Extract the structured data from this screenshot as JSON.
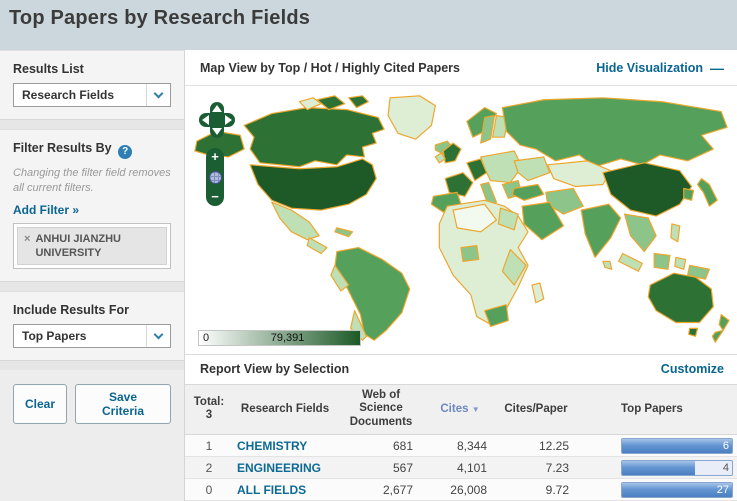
{
  "page": {
    "title": "Top Papers by Research Fields"
  },
  "sidebar": {
    "results_list_label": "Results List",
    "results_list_value": "Research Fields",
    "filter_heading": "Filter Results By",
    "filter_note": "Changing the filter field removes all current filters.",
    "add_filter_label": "Add Filter »",
    "filter_chip": "ANHUI JIANZHU UNIVERSITY",
    "include_label": "Include Results For",
    "include_value": "Top Papers",
    "clear_label": "Clear",
    "save_label": "Save Criteria"
  },
  "icons": {
    "help": "?",
    "close": "×",
    "minus_dash": "—",
    "plus": "+",
    "minus": "−",
    "sort_down": "▼"
  },
  "map_panel": {
    "title": "Map View by Top / Hot / Highly Cited Papers",
    "hide_link": "Hide Visualization",
    "legend_min": "0",
    "legend_max": "79,391",
    "palette": {
      "darkest": "#1d5a27",
      "dark": "#2d7234",
      "medium": "#55a05b",
      "mlight": "#8cc489",
      "light": "#bfe0b5",
      "pale": "#ddeed4",
      "vpale": "#f2f9ee",
      "border": "#eda62d"
    }
  },
  "report": {
    "title": "Report View by Selection",
    "customize_label": "Customize",
    "total_label": "Total:",
    "total_value": "3",
    "columns": [
      "Research Fields",
      "Web of Science Documents",
      "Cites",
      "Cites/Paper",
      "Top Papers"
    ],
    "rows": [
      {
        "rank": "1",
        "field": "CHEMISTRY",
        "docs": "681",
        "cites": "8,344",
        "cites_per_paper": "12.25",
        "top_papers": "6",
        "bar_pct": 100
      },
      {
        "rank": "2",
        "field": "ENGINEERING",
        "docs": "567",
        "cites": "4,101",
        "cites_per_paper": "7.23",
        "top_papers": "4",
        "bar_pct": 66
      },
      {
        "rank": "0",
        "field": "ALL FIELDS",
        "docs": "2,677",
        "cites": "26,008",
        "cites_per_paper": "9.72",
        "top_papers": "27",
        "bar_pct": 100
      }
    ]
  },
  "colors": {
    "header_bg": "#ccd7dd",
    "link": "#0a6591",
    "bar_blue": "#4a7fc0",
    "control_green": "#1b5e33"
  }
}
